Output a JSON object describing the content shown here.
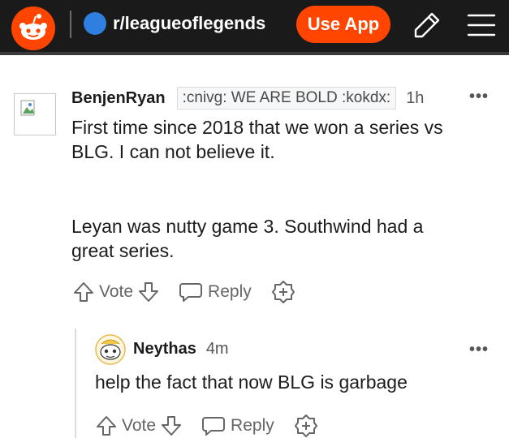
{
  "header": {
    "subreddit": "r/leagueoflegends",
    "use_app_label": "Use App",
    "icons": [
      "reddit-logo-icon",
      "pencil-icon",
      "menu-icon"
    ],
    "colors": {
      "bar": "#1a1a1b",
      "accent": "#ff4500",
      "sub_dot": "#2f7fe0"
    }
  },
  "comments": [
    {
      "author": "BenjenRyan",
      "flair": ":cnivg: WE ARE BOLD :kokdx:",
      "age": "1h",
      "more": "•••",
      "paragraphs": [
        "First time since 2018 that we won a series vs BLG. I can not believe it.",
        "Leyan was nutty game 3. Southwind had a great series."
      ],
      "lines": [
        "First time since 2018 that we won a series vs",
        "BLG. I can not believe it.",
        "Leyan was nutty game 3. Southwind had a",
        "great series."
      ],
      "actions": {
        "vote": "Vote",
        "reply": "Reply"
      }
    },
    {
      "author": "Neythas",
      "age": "4m",
      "more": "•••",
      "text": "help the fact that now BLG is garbage",
      "actions": {
        "vote": "Vote",
        "reply": "Reply"
      }
    }
  ]
}
